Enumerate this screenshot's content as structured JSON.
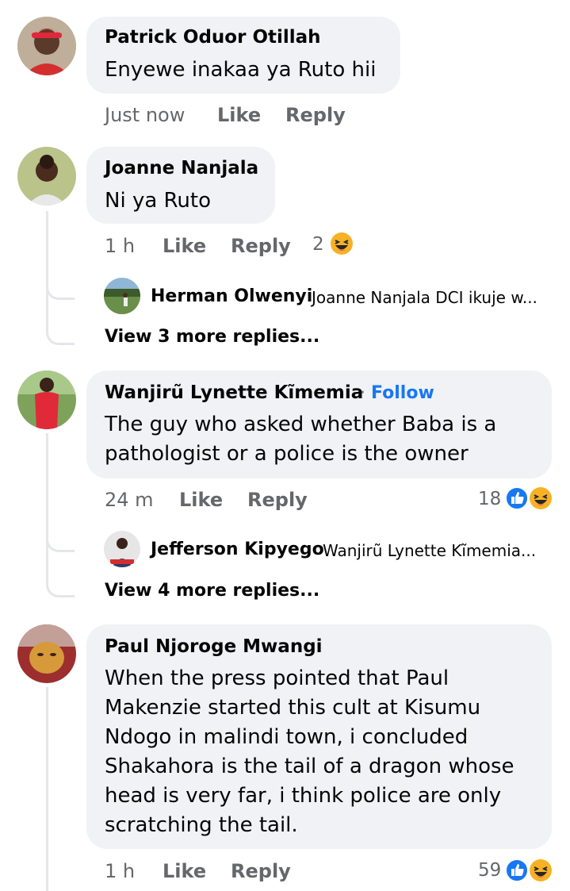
{
  "comments": [
    {
      "author": "Patrick Oduor Otillah",
      "lines": [
        "Enyewe inakaa ya Ruto hii"
      ],
      "time": "Just now",
      "like": "Like",
      "reply": "Reply"
    },
    {
      "author": "Joanne Nanjala",
      "lines": [
        "Ni ya Ruto"
      ],
      "time": "1 h",
      "like": "Like",
      "reply": "Reply",
      "reactions_count": "2",
      "reply_preview": {
        "author": "Herman Olwenyi",
        "text": "Joanne Nanjala  DCI ikuje w..."
      },
      "view_more": "View 3 more replies..."
    },
    {
      "author": "Wanjirũ Lynette Kĩmemia",
      "follow_separator": "·",
      "follow": "Follow",
      "lines": [
        "The guy who asked whether Baba is a",
        "pathologist or a police is the owner"
      ],
      "time": "24 m",
      "like": "Like",
      "reply": "Reply",
      "reactions_count": "18",
      "reply_preview": {
        "author": "Jefferson Kipyego",
        "text": "Wanjirũ Lynette Kĩmemia..."
      },
      "view_more": "View 4 more replies..."
    },
    {
      "author": "Paul Njoroge Mwangi",
      "lines": [
        "When the press pointed that Paul",
        "Makenzie started this cult at Kisumu",
        "Ndogo in malindi town, i concluded",
        "Shakahora is the tail of a dragon whose",
        "head is very far, i think police are only",
        "scratching the tail."
      ],
      "time": "1 h",
      "like": "Like",
      "reply": "Reply",
      "reactions_count": "59"
    }
  ],
  "icons": {
    "like_reaction": "like-reaction-icon",
    "haha_reaction": "haha-reaction-icon"
  },
  "colors": {
    "bubble": "#f0f2f5",
    "meta_text": "#65676b",
    "follow": "#1877f2",
    "like_blue": "#1877f2",
    "haha_yellow": "#f7b125"
  }
}
